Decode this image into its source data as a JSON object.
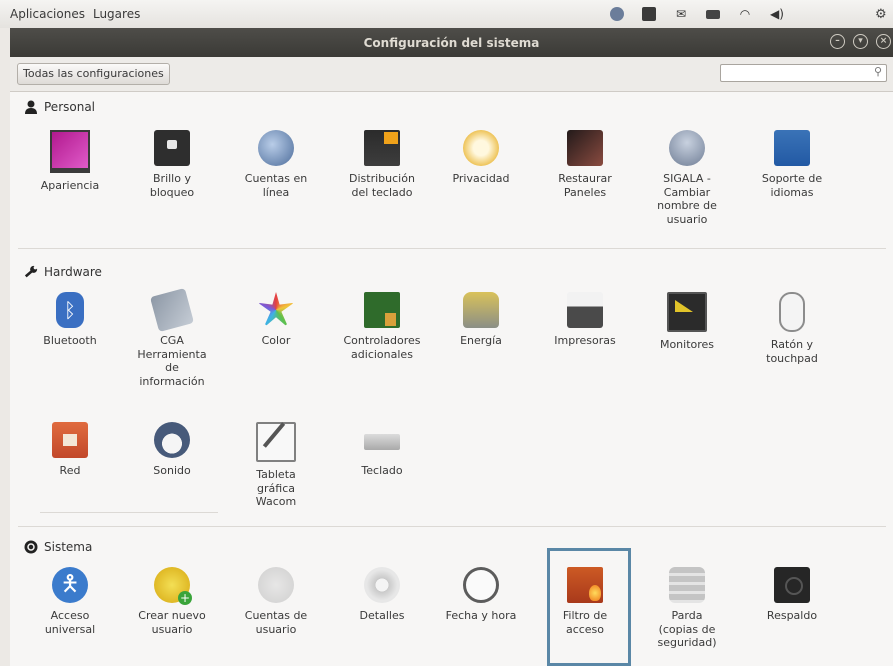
{
  "top_panel": {
    "menu": [
      "Aplicaciones",
      "Lugares"
    ]
  },
  "window": {
    "title": "Configuración del sistema",
    "all_settings_label": "Todas las configuraciones",
    "search_placeholder": ""
  },
  "sections": {
    "personal": {
      "title": "Personal",
      "items": [
        {
          "label": "Apariencia",
          "icon": "apariencia-icon"
        },
        {
          "label": "Brillo y\nbloqueo",
          "icon": "brillo-icon"
        },
        {
          "label": "Cuentas en\nlínea",
          "icon": "cuentas-en-linea-icon"
        },
        {
          "label": "Distribución\ndel teclado",
          "icon": "distribucion-teclado-icon"
        },
        {
          "label": "Privacidad",
          "icon": "privacidad-icon"
        },
        {
          "label": "Restaurar\nPaneles",
          "icon": "restaurar-paneles-icon"
        },
        {
          "label": "SIGALA -\nCambiar\nnombre de\nusuario",
          "icon": "sigala-icon"
        },
        {
          "label": "Soporte de\nidiomas",
          "icon": "soporte-idiomas-icon"
        }
      ]
    },
    "hardware": {
      "title": "Hardware",
      "items": [
        {
          "label": "Bluetooth",
          "icon": "bluetooth-icon"
        },
        {
          "label": "CGA\nHerramienta\nde\ninformación",
          "icon": "cga-icon"
        },
        {
          "label": "Color",
          "icon": "color-icon"
        },
        {
          "label": "Controladores\nadicionales",
          "icon": "controladores-icon"
        },
        {
          "label": "Energía",
          "icon": "energia-icon"
        },
        {
          "label": "Impresoras",
          "icon": "impresoras-icon"
        },
        {
          "label": "Monitores",
          "icon": "monitores-icon"
        },
        {
          "label": "Ratón y\ntouchpad",
          "icon": "raton-icon"
        },
        {
          "label": "Red",
          "icon": "red-icon"
        },
        {
          "label": "Sonido",
          "icon": "sonido-icon"
        },
        {
          "label": "Tableta\ngráfica\nWacom",
          "icon": "tableta-icon"
        },
        {
          "label": "Teclado",
          "icon": "teclado-icon"
        }
      ]
    },
    "sistema": {
      "title": "Sistema",
      "items": [
        {
          "label": "Acceso\nuniversal",
          "icon": "acceso-universal-icon"
        },
        {
          "label": "Crear nuevo\nusuario",
          "icon": "crear-usuario-icon"
        },
        {
          "label": "Cuentas de\nusuario",
          "icon": "cuentas-usuario-icon"
        },
        {
          "label": "Detalles",
          "icon": "detalles-icon"
        },
        {
          "label": "Fecha y hora",
          "icon": "fecha-hora-icon"
        },
        {
          "label": "Filtro de\nacceso",
          "icon": "filtro-acceso-icon"
        },
        {
          "label": "Parda\n(copias de\nseguridad)",
          "icon": "parda-icon"
        },
        {
          "label": "Respaldo",
          "icon": "respaldo-icon"
        }
      ]
    }
  },
  "colors": {
    "titlebar": "#3b3a36",
    "selection": "#5a87a6",
    "background": "#f7f6f5"
  }
}
